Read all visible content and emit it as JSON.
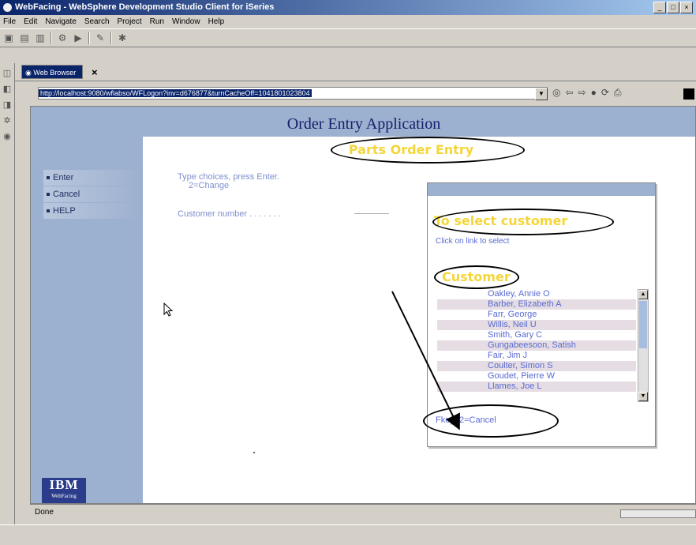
{
  "window": {
    "title": "WebFacing - WebSphere Development Studio Client for iSeries",
    "controls": [
      "_",
      "□",
      "×"
    ]
  },
  "menubar": [
    "File",
    "Edit",
    "Navigate",
    "Search",
    "Project",
    "Run",
    "Window",
    "Help"
  ],
  "toolbar_icons": [
    "new-icon",
    "save-icon",
    "print-icon",
    "debug-icon",
    "run-icon",
    "search-icon"
  ],
  "editor_tab": {
    "label": "Web Browser",
    "close": "×"
  },
  "address": {
    "url": "http://localhost:9080/wflabso/WFLogon?inv=d676877&turnCacheOff=1041801023804"
  },
  "app": {
    "title": "Order Entry Application",
    "subtitle": "Parts Order Entry",
    "commands": [
      "Enter",
      "Cancel",
      "HELP"
    ],
    "instructions": [
      "Type choices, press Enter.",
      "2=Change"
    ],
    "customer_label": "Customer number . . . . . . .",
    "logo": {
      "main": "IBM",
      "sub": "WebFacing"
    }
  },
  "popup": {
    "heading": "To select customer",
    "link_text": "Click on link to select",
    "column_header": "Customer",
    "customers": [
      "Oakley, Annie O",
      "Barber, Elizabeth A",
      "Farr, George",
      "Willis, Neil U",
      "Smith, Gary C",
      "Gungabeesoon, Satish",
      "Fair, Jim J",
      "Coulter, Simon S",
      "Goudet, Pierre W",
      "Llames, Joe L"
    ],
    "fkey": "Fkey12=Cancel"
  },
  "status": {
    "text": "Done"
  },
  "colors": {
    "panel_blue": "#9cb0cf",
    "title_navy": "#14216b",
    "highlight_yellow": "#f4d63a",
    "link_blue": "#5a6bd0"
  }
}
